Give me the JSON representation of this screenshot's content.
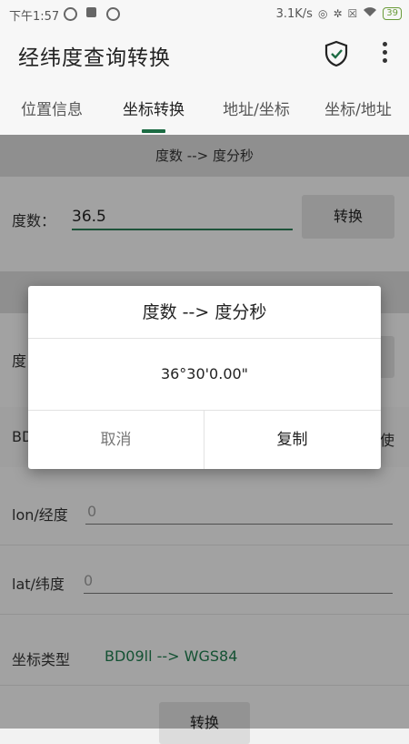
{
  "status_bar": {
    "time": "下午1:57",
    "net_speed": "3.1K/s",
    "battery": "39"
  },
  "app_bar": {
    "title": "经纬度查询转换",
    "icons": [
      "shield-check-icon",
      "more-vert-icon"
    ]
  },
  "tabs": [
    {
      "label": "位置信息"
    },
    {
      "label": "坐标转换",
      "active": true
    },
    {
      "label": "地址/坐标"
    },
    {
      "label": "坐标/地址"
    }
  ],
  "degree_section": {
    "header": "度数 --> 度分秒",
    "label": "度数：",
    "input_value": "36.5",
    "button": "转换"
  },
  "partial": {
    "row_label_start": "度",
    "bd_start": "BD",
    "use_end": "使"
  },
  "coord_section": {
    "lon_label": "lon/经度",
    "lon_placeholder": "0",
    "lat_label": "lat/纬度",
    "lat_placeholder": "0",
    "type_label": "坐标类型",
    "type_value": "BD09ll --> WGS84",
    "button": "转换"
  },
  "dialog": {
    "title": "度数 --> 度分秒",
    "message": "36°30'0.00\"",
    "cancel": "取消",
    "copy": "复制"
  },
  "colors": {
    "accent": "#1c6b43",
    "type_value": "#1e7a4c"
  }
}
